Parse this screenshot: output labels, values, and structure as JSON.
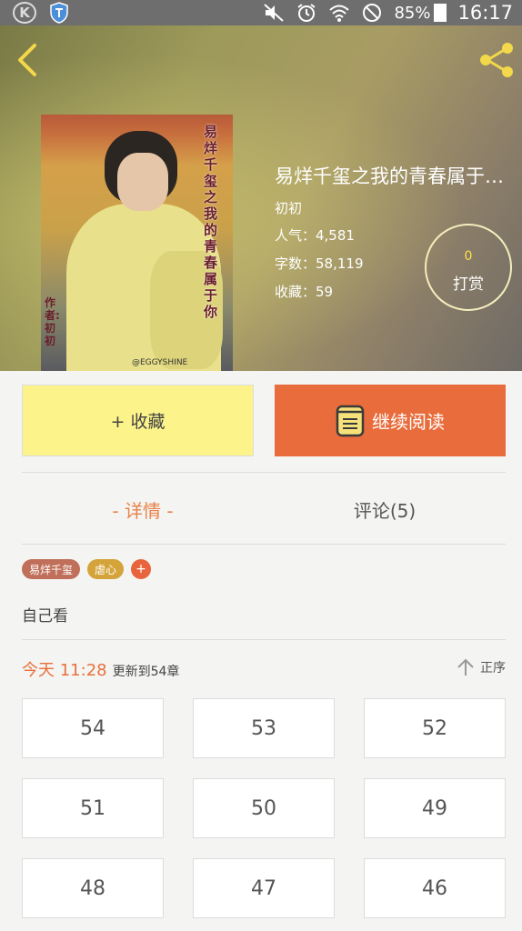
{
  "status_bar": {
    "battery": "85%",
    "time": "16:17"
  },
  "hero": {
    "cover_vertical_title": "易烊千玺之我的青春属于你",
    "cover_author": "作者:初初",
    "cover_watermark": "@EGGYSHINE",
    "title": "易烊千玺之我的青春属于…",
    "author": "初初",
    "popularity": "人气：4,581",
    "word_count": "字数：58,119",
    "favorites": "收藏：59",
    "reward_count": "0",
    "reward_label": "打赏"
  },
  "actions": {
    "favorite_label": "+ 收藏",
    "read_label": "继续阅读",
    "favorite_color": "#fcf48a",
    "read_color": "#e86c3c"
  },
  "tabs": {
    "detail": "- 详情 -",
    "comments": "评论(5)"
  },
  "tags": [
    "易烊千玺",
    "虐心"
  ],
  "tag_add": "+",
  "description": "自己看",
  "update": {
    "time": "今天 11:28",
    "text": "更新到54章",
    "sort_label": "正序"
  },
  "chapters": [
    "54",
    "53",
    "52",
    "51",
    "50",
    "49",
    "48",
    "47",
    "46"
  ]
}
